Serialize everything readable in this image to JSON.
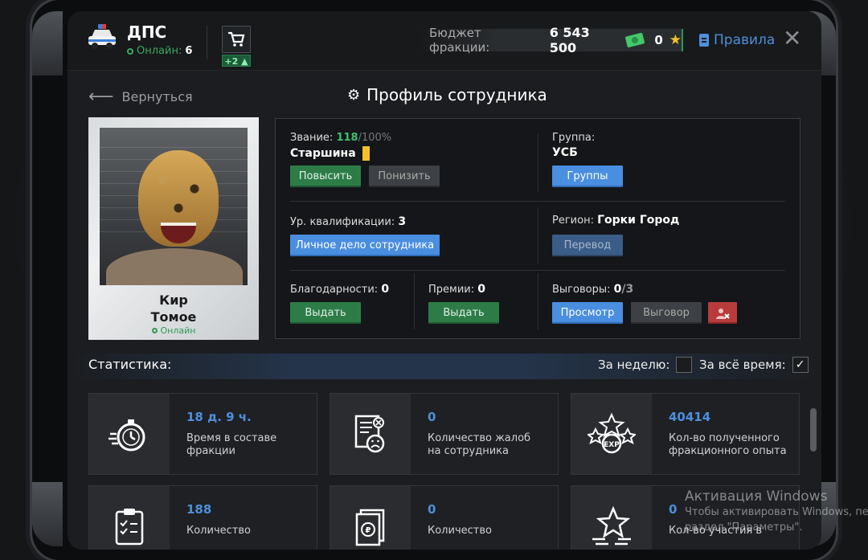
{
  "faction": {
    "name": "ДПС",
    "online_label": "Онлайн:",
    "online_count": "6"
  },
  "shop": {
    "badge": "+2"
  },
  "budget": {
    "label": "Бюджет фракции:",
    "value": "6 543 500",
    "stars": "0"
  },
  "rules_label": "Правила",
  "nav": {
    "back_label": "Вернуться",
    "page_title": "Профиль сотрудника"
  },
  "employee": {
    "first_name": "Кир",
    "last_name": "Томое",
    "status": "Онлайн",
    "rank_label": "Звание:",
    "rank_progress": "118",
    "rank_progress_max": "/100%",
    "rank_name": "Старшина",
    "group_label": "Группа:",
    "group_name": "УСБ",
    "qualification_label": "Ур. квалификации:",
    "qualification_value": "3",
    "region_label": "Регион:",
    "region_name": "Горки Город",
    "thanks_label": "Благодарности:",
    "thanks_value": "0",
    "bonus_label": "Премии:",
    "bonus_value": "0",
    "reprimands_label": "Выговоры:",
    "reprimands_value": "0",
    "reprimands_max": "/3"
  },
  "buttons": {
    "promote": "Повысить",
    "demote": "Понизить",
    "groups": "Группы",
    "personal_file": "Личное дело сотрудника",
    "transfer": "Перевод",
    "give_thanks": "Выдать",
    "give_bonus": "Выдать",
    "view": "Просмотр",
    "reprimand": "Выговор"
  },
  "stats": {
    "title": "Статистика:",
    "week_label": "За неделю:",
    "week_checked": false,
    "all_time_label": "За всё время:",
    "all_time_checked": true,
    "cards": [
      {
        "icon": "stopwatch-icon",
        "value": "18 д. 9 ч.",
        "line1": "Время в составе",
        "line2": "фракции"
      },
      {
        "icon": "complaint-document-icon",
        "value": "0",
        "line1": "Количество жалоб",
        "line2": "на сотрудника"
      },
      {
        "icon": "exp-stars-icon",
        "value": "40414",
        "line1": "Кол-во полученного",
        "line2": "фракционного опыта"
      },
      {
        "icon": "clipboard-checklist-icon",
        "value": "188",
        "line1": "Количество",
        "line2": ""
      },
      {
        "icon": "money-document-icon",
        "value": "0",
        "line1": "Количество",
        "line2": ""
      },
      {
        "icon": "star-speed-icon",
        "value": "0",
        "line1": "Кол-во участия в",
        "line2": ""
      }
    ]
  },
  "windows_watermark": {
    "line1": "Активация Windows",
    "line2": "Чтобы активировать Windows, перейдите в",
    "line3": "раздел \"Параметры\"."
  },
  "colors": {
    "accent_blue": "#4e8fdc",
    "green": "#2d7c48",
    "gold": "#f5c12b",
    "red": "#b83b3b"
  }
}
